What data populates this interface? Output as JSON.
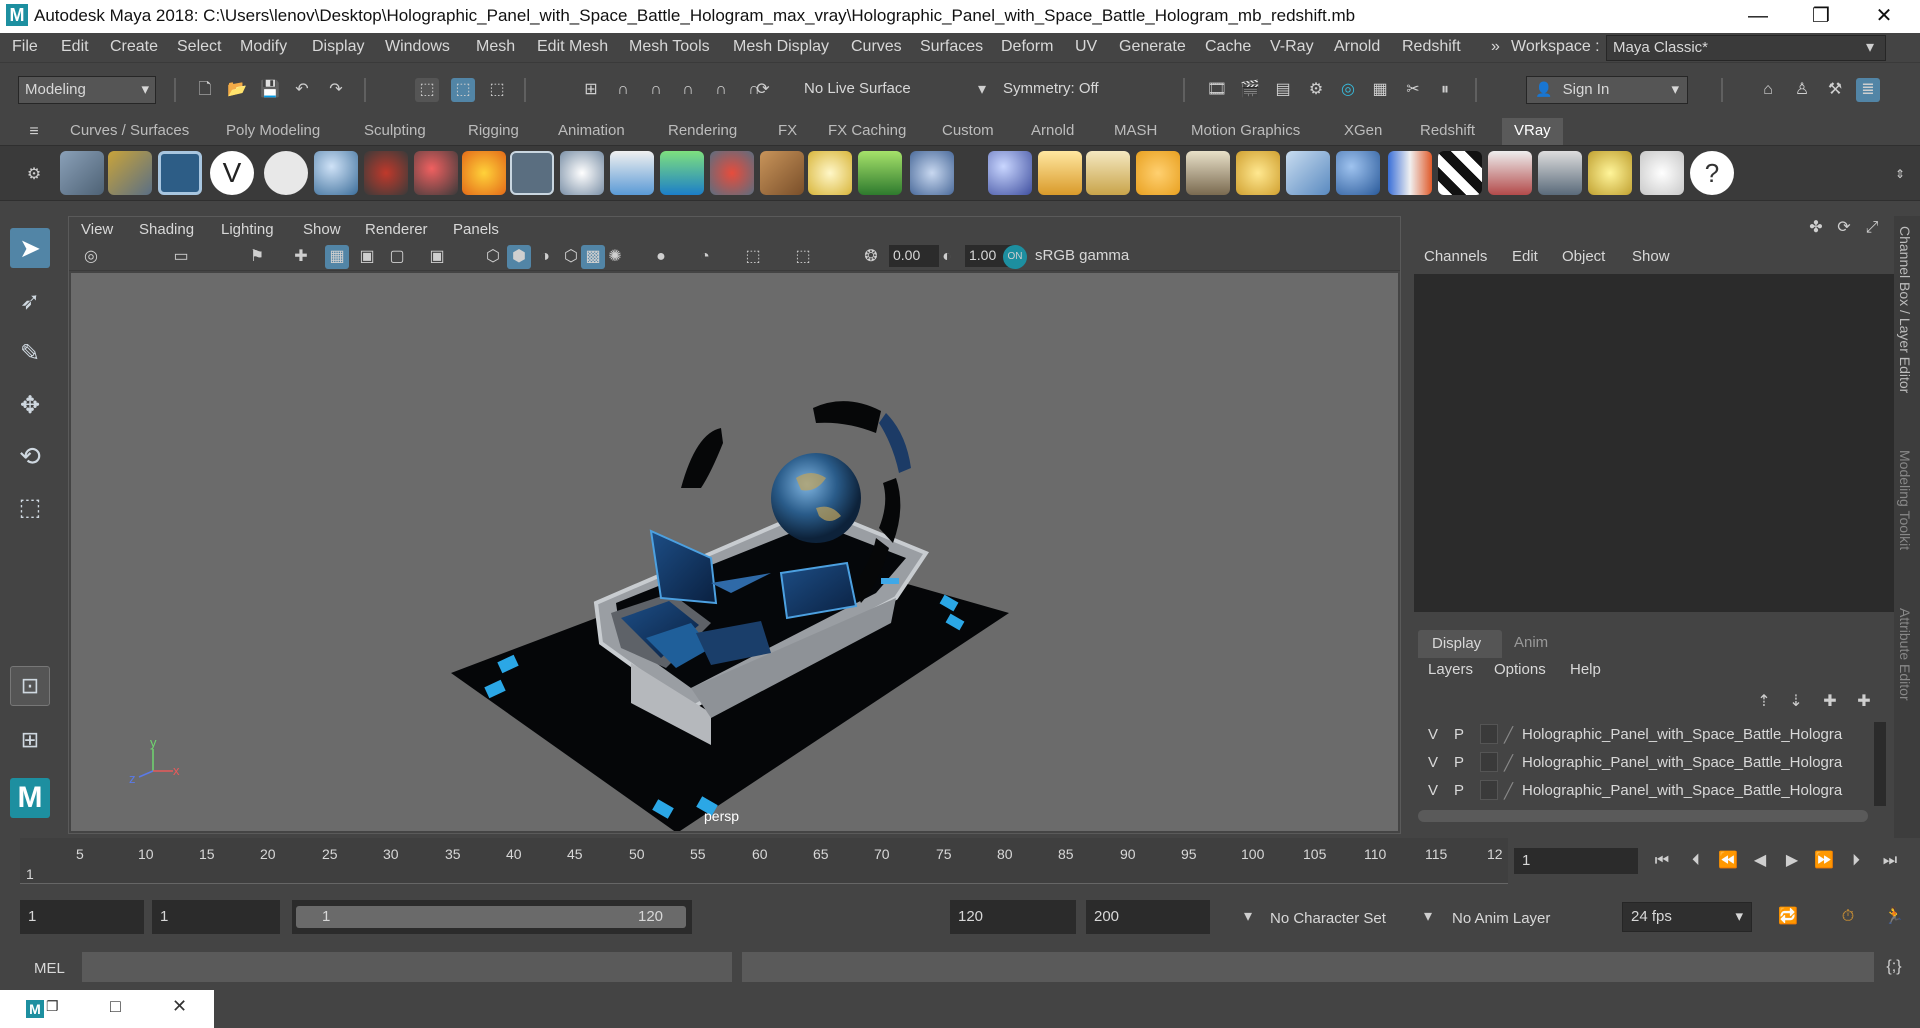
{
  "window": {
    "app_logo": "M",
    "title": "Autodesk Maya 2018: C:\\Users\\lenov\\Desktop\\Holographic_Panel_with_Space_Battle_Hologram_max_vray\\Holographic_Panel_with_Space_Battle_Hologram_mb_redshift.mb",
    "minimize": "—",
    "restore": "❐",
    "close": "✕"
  },
  "menubar": {
    "items": [
      "File",
      "Edit",
      "Create",
      "Select",
      "Modify",
      "Display",
      "Windows",
      "Mesh",
      "Edit Mesh",
      "Mesh Tools",
      "Mesh Display",
      "Curves",
      "Surfaces",
      "Deform",
      "UV",
      "Generate",
      "Cache",
      "V-Ray",
      "Arnold",
      "Redshift"
    ],
    "overflow": "»",
    "workspace_label": "Workspace :",
    "workspace_value": "Maya Classic*"
  },
  "toolbar": {
    "mode": "Modeling",
    "live_surface": "No Live Surface",
    "symmetry": "Symmetry: Off",
    "sign_in": "Sign In"
  },
  "shelf": {
    "tabs": [
      "Curves / Surfaces",
      "Poly Modeling",
      "Sculpting",
      "Rigging",
      "Animation",
      "Rendering",
      "FX",
      "FX Caching",
      "Custom",
      "Arnold",
      "MASH",
      "Motion Graphics",
      "XGen",
      "Redshift",
      "VRay"
    ],
    "active_tab": "VRay"
  },
  "viewport": {
    "menus": [
      "View",
      "Shading",
      "Lighting",
      "Show",
      "Renderer",
      "Panels"
    ],
    "exposure": "0.00",
    "gamma": "1.00",
    "color_space": "sRGB gamma",
    "camera_label": "persp",
    "axis_y": "y",
    "axis_x": "x",
    "axis_z": "z"
  },
  "channelbox": {
    "menus": [
      "Channels",
      "Edit",
      "Object",
      "Show"
    ],
    "layer_tabs": [
      "Display",
      "Anim"
    ],
    "layer_menus": [
      "Layers",
      "Options",
      "Help"
    ],
    "layers": [
      {
        "v": "V",
        "p": "P",
        "name": "Holographic_Panel_with_Space_Battle_Hologra"
      },
      {
        "v": "V",
        "p": "P",
        "name": "Holographic_Panel_with_Space_Battle_Hologra"
      },
      {
        "v": "V",
        "p": "P",
        "name": "Holographic_Panel_with_Space_Battle_Hologra"
      }
    ]
  },
  "side_tabs": [
    "Channel Box / Layer Editor",
    "Modeling Toolkit",
    "Attribute Editor"
  ],
  "timeline": {
    "ticks": [
      "5",
      "10",
      "15",
      "20",
      "25",
      "30",
      "35",
      "40",
      "45",
      "50",
      "55",
      "60",
      "65",
      "70",
      "75",
      "80",
      "85",
      "90",
      "95",
      "100",
      "105",
      "110",
      "115",
      "12"
    ],
    "start_marker": "1",
    "current_frame": "1"
  },
  "range": {
    "start": "1",
    "playback_start": "1",
    "slider_start": "1",
    "slider_end": "120",
    "playback_end": "120",
    "end": "200",
    "character_set": "No Character Set",
    "anim_layer": "No Anim Layer",
    "fps": "24 fps"
  },
  "cmdline": {
    "label": "MEL"
  },
  "colors": {
    "accent": "#5285a6",
    "maya_teal": "#1d8fa0",
    "panel_bg": "#444444",
    "viewport_bg": "#6b6b6b"
  }
}
